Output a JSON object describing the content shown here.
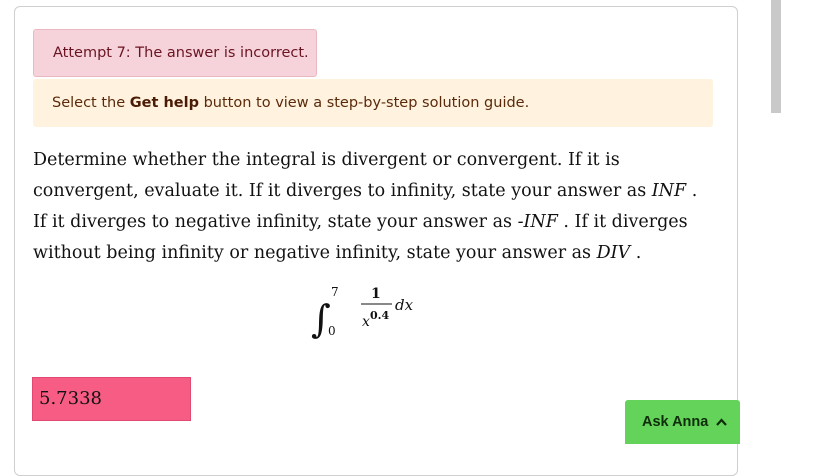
{
  "feedback": {
    "error_text": "Attempt 7: The answer is incorrect.",
    "help_prefix": "Select the ",
    "help_button_name": "Get help",
    "help_suffix": " button to view a step-by-step solution guide."
  },
  "question": {
    "part1": "Determine whether the integral is divergent or convergent. If it is convergent, evaluate it. If it diverges to infinity, state your answer as ",
    "inf": "INF",
    "part2": " . If it diverges to negative infinity, state your answer as ",
    "neg_inf": "-INF",
    "part3": " . If it diverges without being infinity or negative infinity, state your answer as ",
    "div": "DIV",
    "part4": " ."
  },
  "formula": {
    "upper": "7",
    "lower": "0",
    "numerator": "1",
    "denominator_base": "x",
    "exponent": "0.4",
    "differential": "dx"
  },
  "answer": {
    "value": "5.7338"
  },
  "assistant": {
    "label": "Ask Anna"
  },
  "colors": {
    "error_bg": "#f6d3da",
    "info_bg": "#fff2df",
    "answer_bg": "#f75c84",
    "assistant_bg": "#63d35a"
  }
}
